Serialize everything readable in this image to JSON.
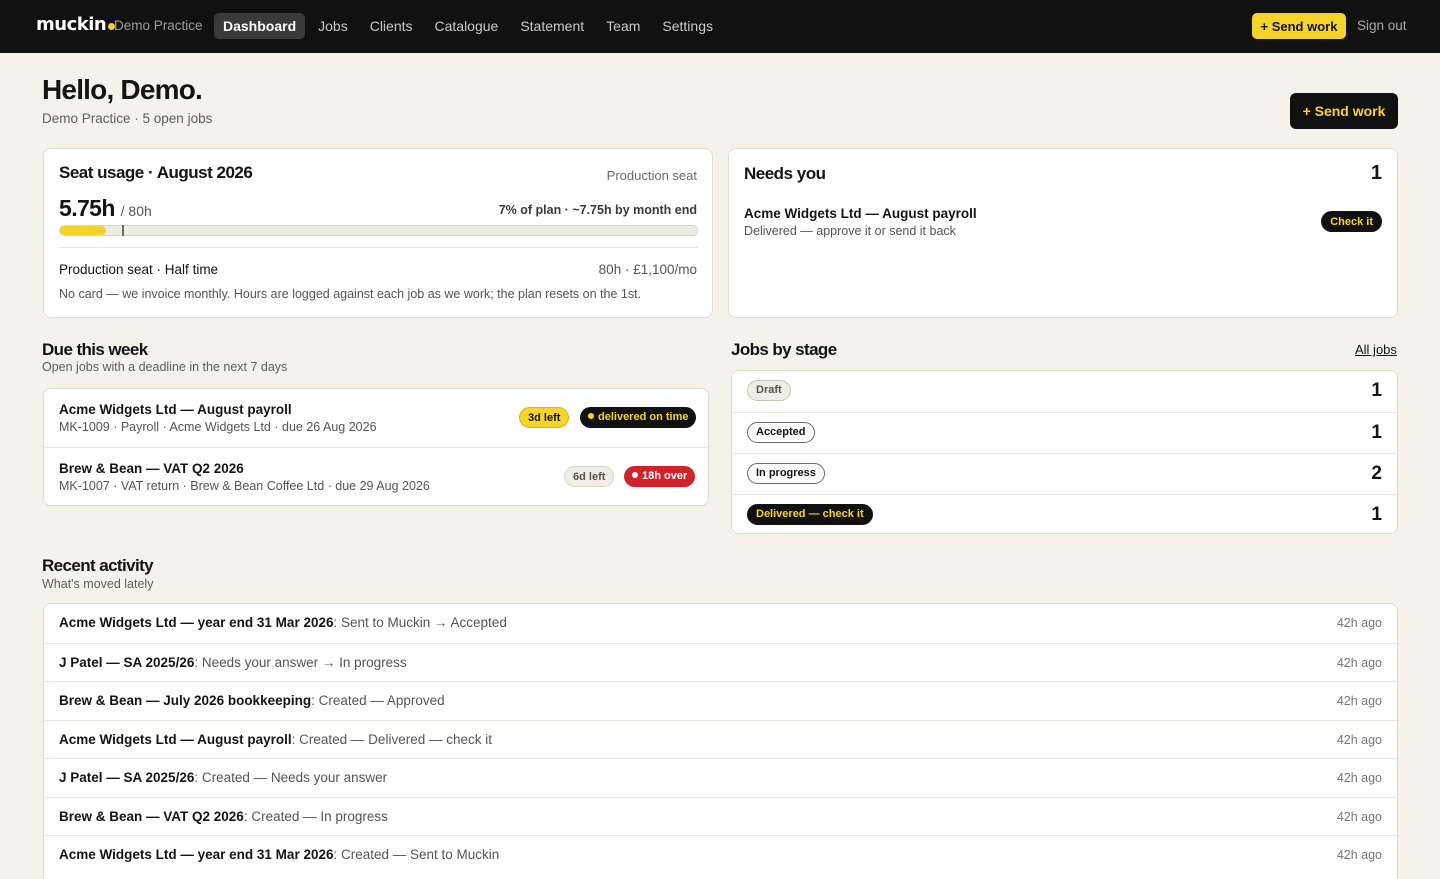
{
  "nav": {
    "logo": "muckin",
    "practice": "Demo Practice",
    "items": [
      "Dashboard",
      "Jobs",
      "Clients",
      "Catalogue",
      "Statement",
      "Team",
      "Settings"
    ],
    "active": "Dashboard",
    "send_work": "+ Send work",
    "sign_out": "Sign out"
  },
  "header": {
    "greeting": "Hello, Demo.",
    "subtitle": "Demo Practice · 5 open jobs",
    "send_work": "+ Send work"
  },
  "seat": {
    "title": "Seat usage · August 2026",
    "type": "Production seat",
    "hours_used": "5.75h",
    "hours_total": "/ 80h",
    "plan_summary": "7% of plan · ~7.75h by month end",
    "used_fraction": 0.072,
    "projected_fraction": 0.097,
    "plan_name": "Production seat · Half time",
    "plan_price": "80h · £1,100/mo",
    "note": "No card — we invoice monthly. Hours are logged against each job as we work; the plan resets on the 1st."
  },
  "needs": {
    "title": "Needs you",
    "count": "1",
    "job": "Acme Widgets Ltd — August payroll",
    "desc": "Delivered — approve it or send it back",
    "action": "Check it"
  },
  "due": {
    "title": "Due this week",
    "subtitle": "Open jobs with a deadline in the next 7 days",
    "rows": [
      {
        "name": "Acme Widgets Ltd — August payroll",
        "meta": "MK-1009 · Payroll · Acme Widgets Ltd · due 26 Aug 2026",
        "left": "3d left",
        "status": "delivered on time"
      },
      {
        "name": "Brew & Bean — VAT Q2 2026",
        "meta": "MK-1007 · VAT return · Brew & Bean Coffee Ltd · due 29 Aug 2026",
        "left": "6d left",
        "status": "18h over"
      }
    ]
  },
  "stages": {
    "title": "Jobs by stage",
    "link": "All jobs",
    "rows": [
      {
        "label": "Draft",
        "count": "1"
      },
      {
        "label": "Accepted",
        "count": "1"
      },
      {
        "label": "In progress",
        "count": "2"
      },
      {
        "label": "Delivered — check it",
        "count": "1"
      }
    ]
  },
  "activity": {
    "title": "Recent activity",
    "subtitle": "What's moved lately",
    "rows": [
      {
        "job": "Acme Widgets Ltd — year end 31 Mar 2026",
        "change": ": Sent to Muckin → Accepted",
        "time": "42h ago"
      },
      {
        "job": "J Patel — SA 2025/26",
        "change": ": Needs your answer → In progress",
        "time": "42h ago"
      },
      {
        "job": "Brew & Bean — July 2026 bookkeeping",
        "change": ": Created — Approved",
        "time": "42h ago"
      },
      {
        "job": "Acme Widgets Ltd — August payroll",
        "change": ": Created — Delivered — check it",
        "time": "42h ago"
      },
      {
        "job": "J Patel — SA 2025/26",
        "change": ": Created — Needs your answer",
        "time": "42h ago"
      },
      {
        "job": "Brew & Bean — VAT Q2 2026",
        "change": ": Created — In progress",
        "time": "42h ago"
      },
      {
        "job": "Acme Widgets Ltd — year end 31 Mar 2026",
        "change": ": Created — Sent to Muckin",
        "time": "42h ago"
      }
    ]
  },
  "colors": {
    "accent": "#f5d327",
    "dark": "#111111",
    "danger": "#d3232a",
    "background": "#f4f2ea"
  }
}
